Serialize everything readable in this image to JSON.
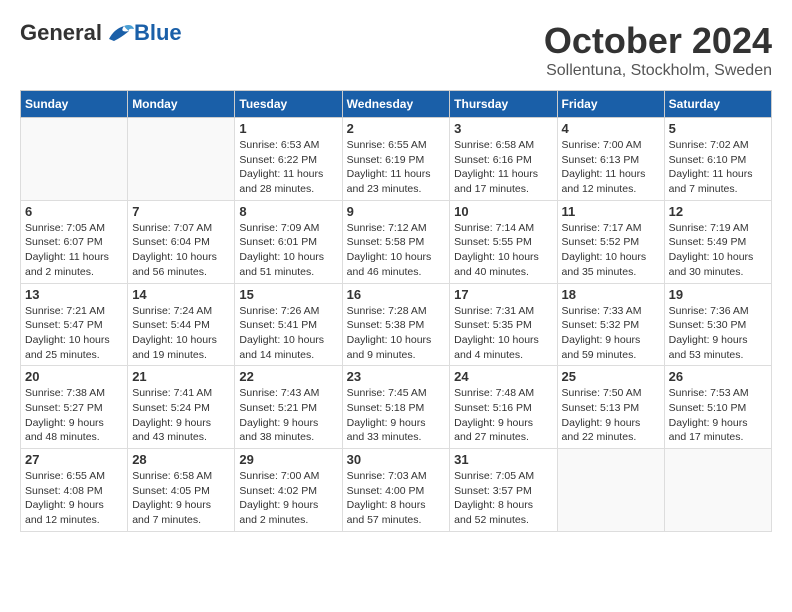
{
  "header": {
    "logo_general": "General",
    "logo_blue": "Blue",
    "month_title": "October 2024",
    "location": "Sollentuna, Stockholm, Sweden"
  },
  "weekdays": [
    "Sunday",
    "Monday",
    "Tuesday",
    "Wednesday",
    "Thursday",
    "Friday",
    "Saturday"
  ],
  "weeks": [
    [
      {
        "day": "",
        "info": ""
      },
      {
        "day": "",
        "info": ""
      },
      {
        "day": "1",
        "info": "Sunrise: 6:53 AM\nSunset: 6:22 PM\nDaylight: 11 hours and 28 minutes."
      },
      {
        "day": "2",
        "info": "Sunrise: 6:55 AM\nSunset: 6:19 PM\nDaylight: 11 hours and 23 minutes."
      },
      {
        "day": "3",
        "info": "Sunrise: 6:58 AM\nSunset: 6:16 PM\nDaylight: 11 hours and 17 minutes."
      },
      {
        "day": "4",
        "info": "Sunrise: 7:00 AM\nSunset: 6:13 PM\nDaylight: 11 hours and 12 minutes."
      },
      {
        "day": "5",
        "info": "Sunrise: 7:02 AM\nSunset: 6:10 PM\nDaylight: 11 hours and 7 minutes."
      }
    ],
    [
      {
        "day": "6",
        "info": "Sunrise: 7:05 AM\nSunset: 6:07 PM\nDaylight: 11 hours and 2 minutes."
      },
      {
        "day": "7",
        "info": "Sunrise: 7:07 AM\nSunset: 6:04 PM\nDaylight: 10 hours and 56 minutes."
      },
      {
        "day": "8",
        "info": "Sunrise: 7:09 AM\nSunset: 6:01 PM\nDaylight: 10 hours and 51 minutes."
      },
      {
        "day": "9",
        "info": "Sunrise: 7:12 AM\nSunset: 5:58 PM\nDaylight: 10 hours and 46 minutes."
      },
      {
        "day": "10",
        "info": "Sunrise: 7:14 AM\nSunset: 5:55 PM\nDaylight: 10 hours and 40 minutes."
      },
      {
        "day": "11",
        "info": "Sunrise: 7:17 AM\nSunset: 5:52 PM\nDaylight: 10 hours and 35 minutes."
      },
      {
        "day": "12",
        "info": "Sunrise: 7:19 AM\nSunset: 5:49 PM\nDaylight: 10 hours and 30 minutes."
      }
    ],
    [
      {
        "day": "13",
        "info": "Sunrise: 7:21 AM\nSunset: 5:47 PM\nDaylight: 10 hours and 25 minutes."
      },
      {
        "day": "14",
        "info": "Sunrise: 7:24 AM\nSunset: 5:44 PM\nDaylight: 10 hours and 19 minutes."
      },
      {
        "day": "15",
        "info": "Sunrise: 7:26 AM\nSunset: 5:41 PM\nDaylight: 10 hours and 14 minutes."
      },
      {
        "day": "16",
        "info": "Sunrise: 7:28 AM\nSunset: 5:38 PM\nDaylight: 10 hours and 9 minutes."
      },
      {
        "day": "17",
        "info": "Sunrise: 7:31 AM\nSunset: 5:35 PM\nDaylight: 10 hours and 4 minutes."
      },
      {
        "day": "18",
        "info": "Sunrise: 7:33 AM\nSunset: 5:32 PM\nDaylight: 9 hours and 59 minutes."
      },
      {
        "day": "19",
        "info": "Sunrise: 7:36 AM\nSunset: 5:30 PM\nDaylight: 9 hours and 53 minutes."
      }
    ],
    [
      {
        "day": "20",
        "info": "Sunrise: 7:38 AM\nSunset: 5:27 PM\nDaylight: 9 hours and 48 minutes."
      },
      {
        "day": "21",
        "info": "Sunrise: 7:41 AM\nSunset: 5:24 PM\nDaylight: 9 hours and 43 minutes."
      },
      {
        "day": "22",
        "info": "Sunrise: 7:43 AM\nSunset: 5:21 PM\nDaylight: 9 hours and 38 minutes."
      },
      {
        "day": "23",
        "info": "Sunrise: 7:45 AM\nSunset: 5:18 PM\nDaylight: 9 hours and 33 minutes."
      },
      {
        "day": "24",
        "info": "Sunrise: 7:48 AM\nSunset: 5:16 PM\nDaylight: 9 hours and 27 minutes."
      },
      {
        "day": "25",
        "info": "Sunrise: 7:50 AM\nSunset: 5:13 PM\nDaylight: 9 hours and 22 minutes."
      },
      {
        "day": "26",
        "info": "Sunrise: 7:53 AM\nSunset: 5:10 PM\nDaylight: 9 hours and 17 minutes."
      }
    ],
    [
      {
        "day": "27",
        "info": "Sunrise: 6:55 AM\nSunset: 4:08 PM\nDaylight: 9 hours and 12 minutes."
      },
      {
        "day": "28",
        "info": "Sunrise: 6:58 AM\nSunset: 4:05 PM\nDaylight: 9 hours and 7 minutes."
      },
      {
        "day": "29",
        "info": "Sunrise: 7:00 AM\nSunset: 4:02 PM\nDaylight: 9 hours and 2 minutes."
      },
      {
        "day": "30",
        "info": "Sunrise: 7:03 AM\nSunset: 4:00 PM\nDaylight: 8 hours and 57 minutes."
      },
      {
        "day": "31",
        "info": "Sunrise: 7:05 AM\nSunset: 3:57 PM\nDaylight: 8 hours and 52 minutes."
      },
      {
        "day": "",
        "info": ""
      },
      {
        "day": "",
        "info": ""
      }
    ]
  ]
}
